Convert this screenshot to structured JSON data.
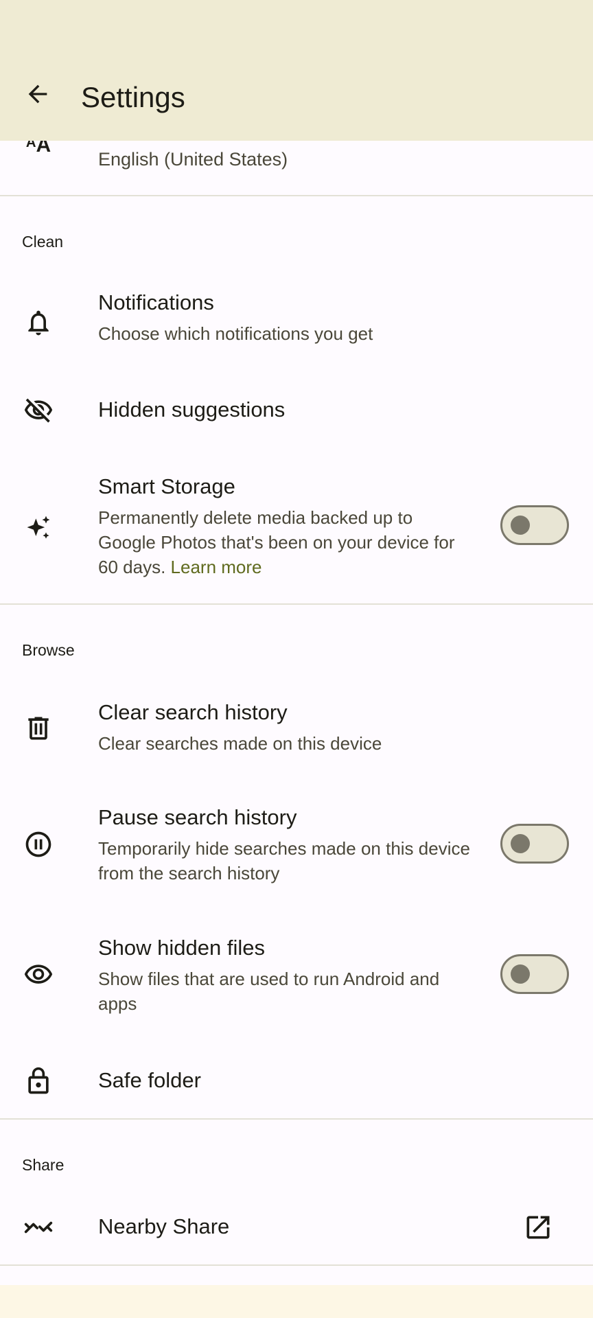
{
  "app_bar": {
    "title": "Settings"
  },
  "language": {
    "glyph": "ᴬA",
    "value": "English (United States)"
  },
  "sections": {
    "clean": "Clean",
    "browse": "Browse",
    "share": "Share"
  },
  "items": {
    "notifications": {
      "title": "Notifications",
      "subtitle": "Choose which notifications you get"
    },
    "hidden_suggestions": {
      "title": "Hidden suggestions"
    },
    "smart_storage": {
      "title": "Smart Storage",
      "subtitle": "Permanently delete media backed up to Google Photos that's been on your device for 60 days.",
      "link": "Learn more",
      "enabled": false
    },
    "clear_history": {
      "title": "Clear search history",
      "subtitle": "Clear searches made on this device"
    },
    "pause_history": {
      "title": "Pause search history",
      "subtitle": "Temporarily hide searches made on this device from the search history",
      "enabled": false
    },
    "show_hidden": {
      "title": "Show hidden files",
      "subtitle": "Show files that are used to run Android and apps",
      "enabled": false
    },
    "safe_folder": {
      "title": "Safe folder"
    },
    "nearby_share": {
      "title": "Nearby Share"
    }
  },
  "colors": {
    "app_bar": "#efebd3",
    "background": "#fefbff",
    "accent_link": "#606b1f",
    "switch_off": "#e8e5d4"
  }
}
